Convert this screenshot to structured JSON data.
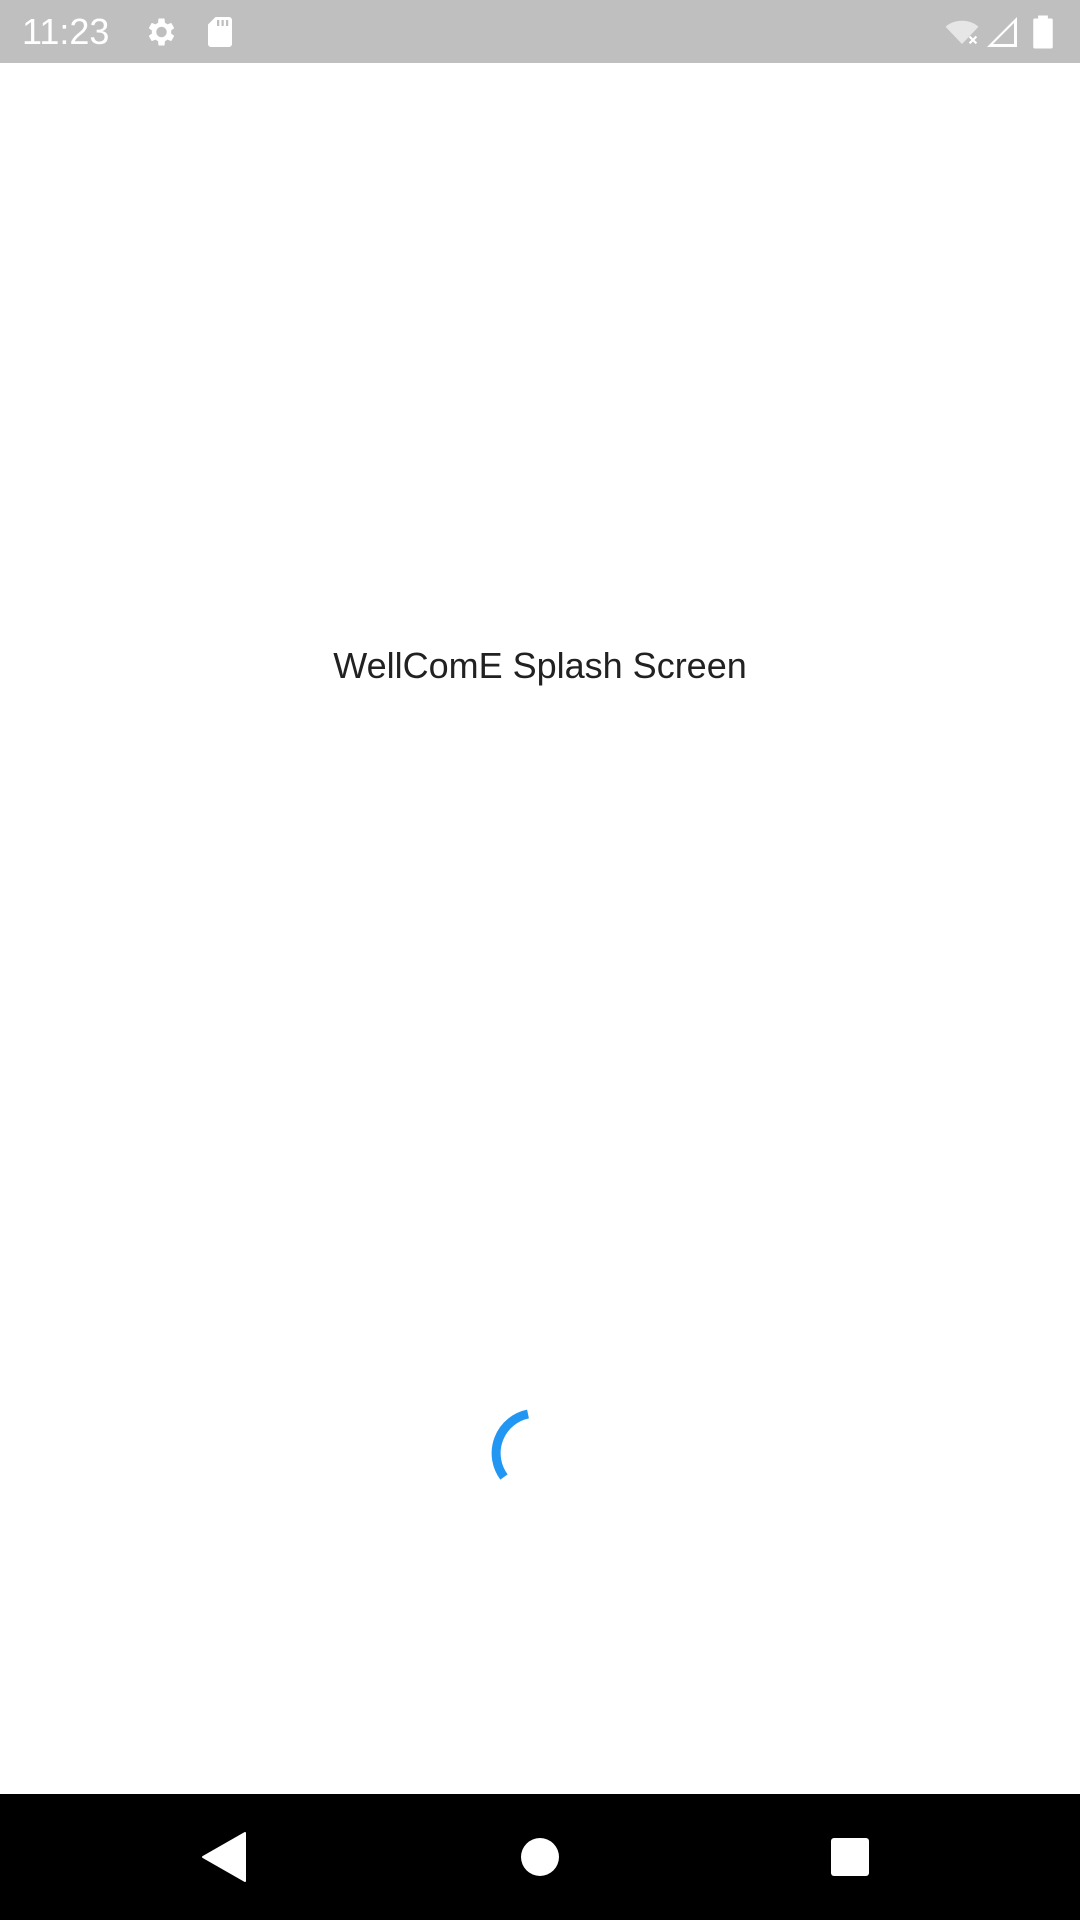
{
  "status_bar": {
    "time": "11:23",
    "icons": [
      "settings-icon",
      "sd-card-icon",
      "wifi-off-icon",
      "cell-signal-icon",
      "battery-icon"
    ],
    "background_color": "#bfbfbf"
  },
  "main": {
    "title": "WellComE Splash Screen",
    "spinner_color": "#2196f3"
  },
  "nav_bar": {
    "buttons": [
      "back-icon",
      "home-icon",
      "recents-icon"
    ],
    "background_color": "#000000"
  }
}
